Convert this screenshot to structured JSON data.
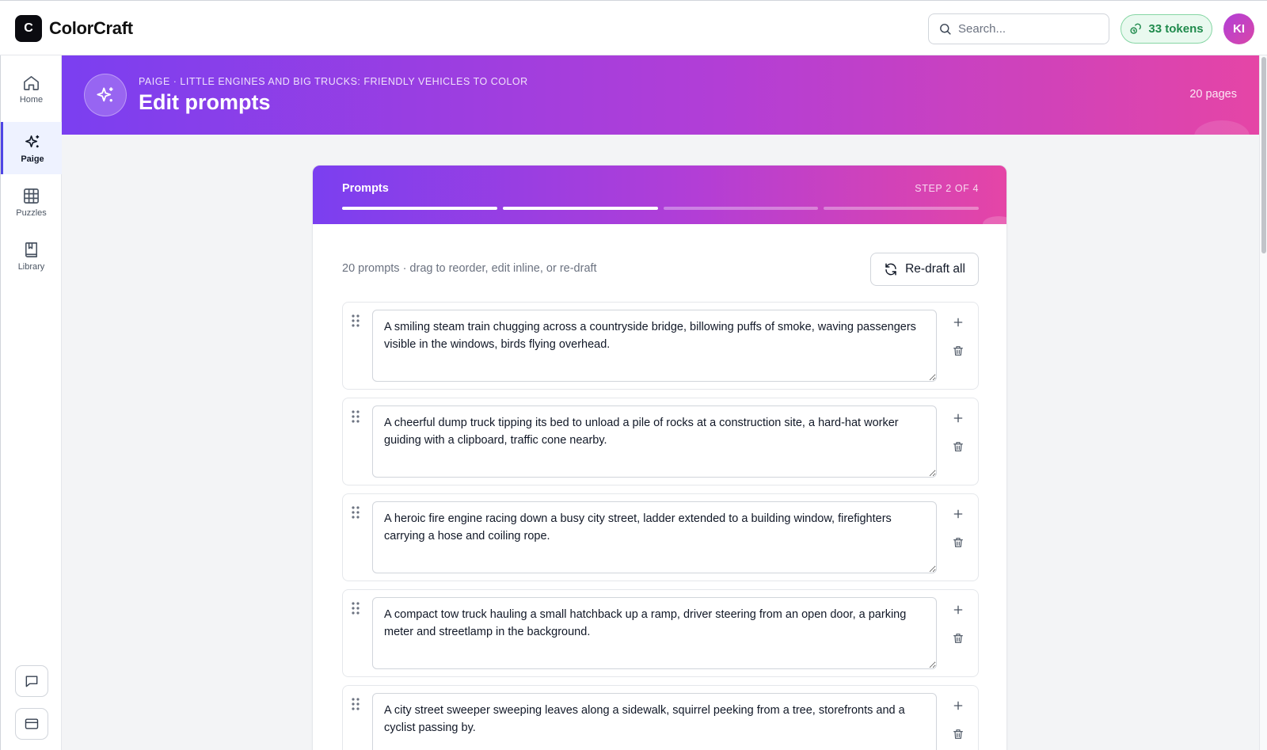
{
  "app": {
    "logo_letter": "C",
    "name": "ColorCraft"
  },
  "header": {
    "search_placeholder": "Search...",
    "tokens_label": "33 tokens",
    "avatar_initials": "KI",
    "token_color": "#1f8a4c"
  },
  "sidebar": {
    "items": [
      {
        "label": "Home",
        "icon": "home-icon"
      },
      {
        "label": "Paige",
        "icon": "sparkles-icon",
        "active": true
      },
      {
        "label": "Puzzles",
        "icon": "grid-icon"
      },
      {
        "label": "Library",
        "icon": "book-icon"
      }
    ],
    "bottom_icons": [
      "chat-icon",
      "card-icon"
    ]
  },
  "hero": {
    "breadcrumb": "Paige · Little Engines and Big Trucks: Friendly Vehicles to Color",
    "title": "Edit prompts",
    "pages": "20 pages",
    "gradient": [
      "#7b3ff0",
      "#b23ed6",
      "#e545a6"
    ]
  },
  "card": {
    "title": "Prompts",
    "step": "Step 2 of 4",
    "progress_completed": 2,
    "progress_total": 4,
    "summary": "20 prompts · drag to reorder, edit inline, or re-draft",
    "redraft_label": "Re-draft all",
    "prompts": [
      "A smiling steam train chugging across a countryside bridge, billowing puffs of smoke, waving passengers visible in the windows, birds flying overhead.",
      "A cheerful dump truck tipping its bed to unload a pile of rocks at a construction site, a hard-hat worker guiding with a clipboard, traffic cone nearby.",
      "A heroic fire engine racing down a busy city street, ladder extended to a building window, firefighters carrying a hose and coiling rope.",
      "A compact tow truck hauling a small hatchback up a ramp, driver steering from an open door, a parking meter and streetlamp in the background.",
      "A city street sweeper sweeping leaves along a sidewalk, squirrel peeking from a tree, storefronts and a cyclist passing by."
    ]
  }
}
